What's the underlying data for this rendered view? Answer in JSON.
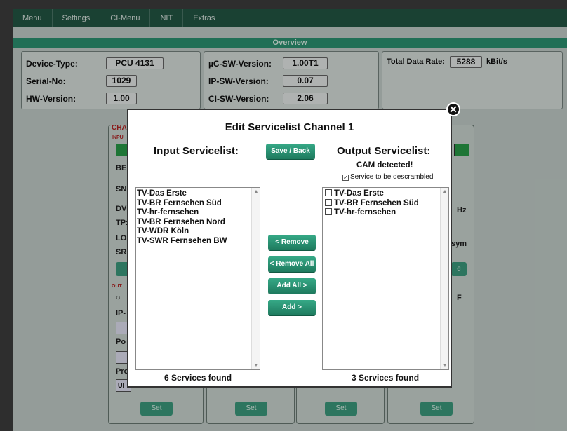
{
  "menu": [
    "Menu",
    "Settings",
    "CI-Menu",
    "NIT",
    "Extras"
  ],
  "overview_title": "Overview",
  "info": {
    "device_type_label": "Device-Type:",
    "device_type": "PCU 4131",
    "serial_label": "Serial-No:",
    "serial": "1029",
    "hw_label": "HW-Version:",
    "hw": "1.00",
    "uc_sw_label": "µC-SW-Version:",
    "uc_sw": "1.00T1",
    "ip_sw_label": "IP-SW-Version:",
    "ip_sw": "0.07",
    "ci_sw_label": "CI-SW-Version:",
    "ci_sw": "2.06",
    "rate_label": "Total Data Rate:",
    "rate": "5288",
    "rate_unit": "kBit/s"
  },
  "bg": {
    "cha": "CHA",
    "inpu": "INPU",
    "ber": "BEI",
    "sni": "SNI",
    "dvi": "DVI",
    "tp": "TP:",
    "lo": "LO:",
    "sr": "SR:",
    "outp": "OUT",
    "ip": "IP-",
    "po": "Po",
    "pro": "Pro",
    "ul": "Ul",
    "hz": "Hz",
    "sym": "sym",
    "e": "e",
    "f": "F",
    "set": "Set"
  },
  "modal": {
    "title": "Edit Servicelist Channel 1",
    "input_header": "Input Servicelist:",
    "output_header": "Output Servicelist:",
    "save_back": "Save / Back",
    "cam_detected": "CAM detected!",
    "descramble_label": "Service to be descrambled",
    "input_services": [
      "TV-Das Erste",
      "TV-BR Fernsehen Süd",
      "TV-hr-fernsehen",
      "TV-BR Fernsehen Nord",
      "TV-WDR Köln",
      "TV-SWR Fernsehen BW"
    ],
    "output_services": [
      "TV-Das Erste",
      "TV-BR Fernsehen Süd",
      "TV-hr-fernsehen"
    ],
    "remove": "< Remove",
    "remove_all": "< Remove All",
    "add_all": "Add All >",
    "add": "Add >",
    "input_count": "6 Services found",
    "output_count": "3 Services found"
  },
  "colors": {
    "menubar": "#245a47",
    "accent": "#2f9a78",
    "button": "#1e7a5e",
    "overlay_bg": "#cdd9d4"
  }
}
